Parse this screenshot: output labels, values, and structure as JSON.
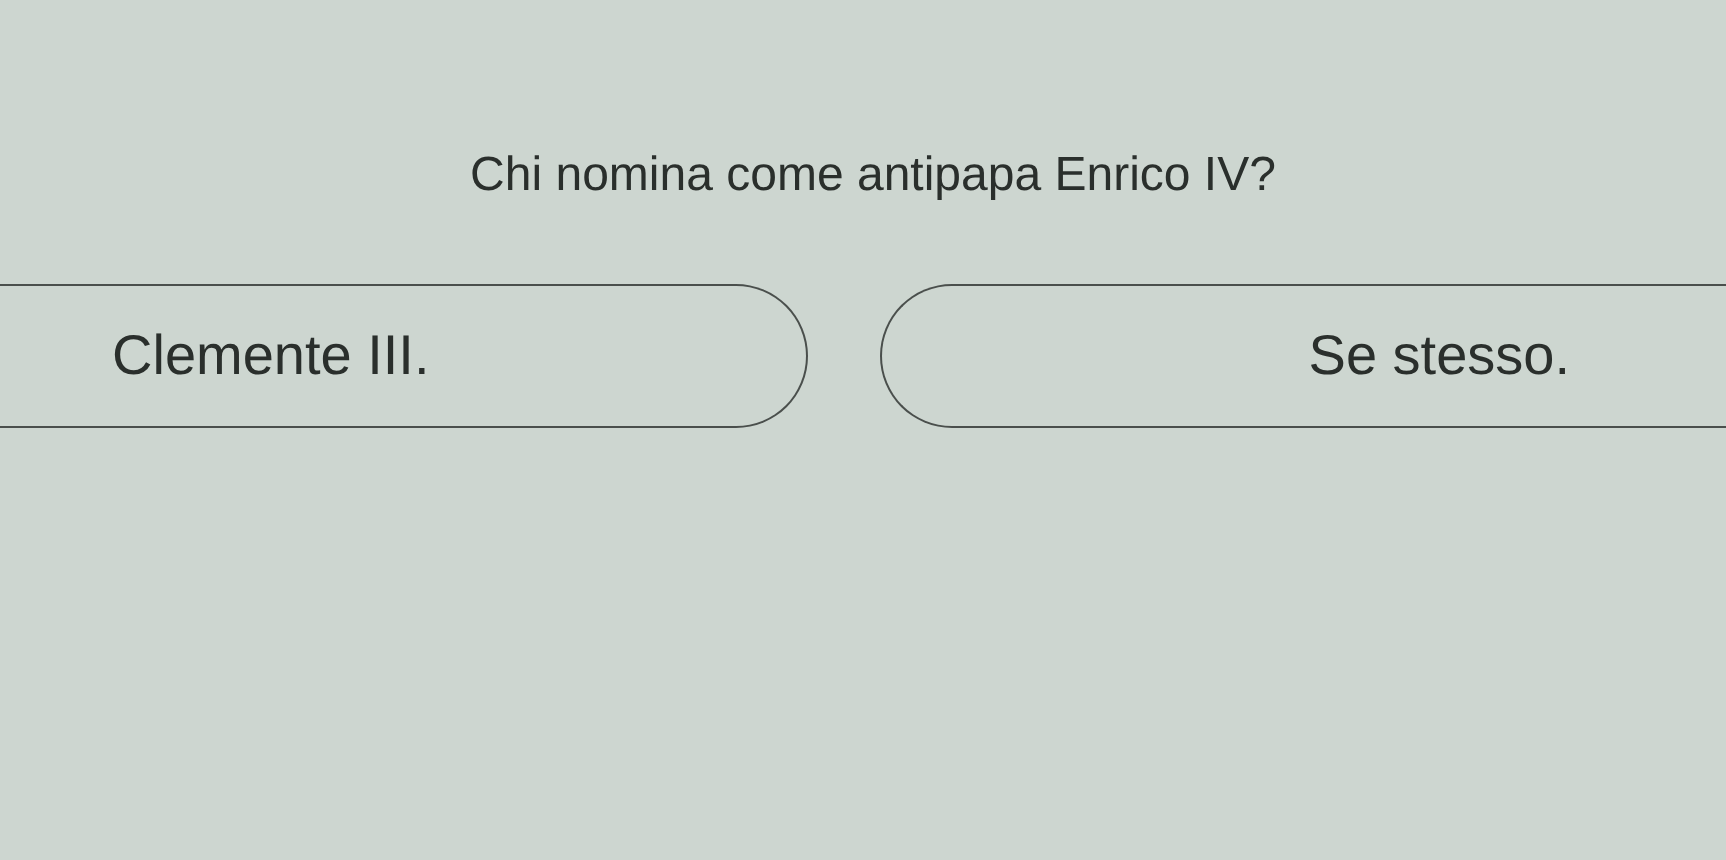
{
  "question": "Chi nomina come antipapa Enrico IV?",
  "answers": [
    {
      "label": "Clemente III.",
      "kind": "left"
    },
    {
      "label": "Se stesso.",
      "kind": "right"
    }
  ]
}
